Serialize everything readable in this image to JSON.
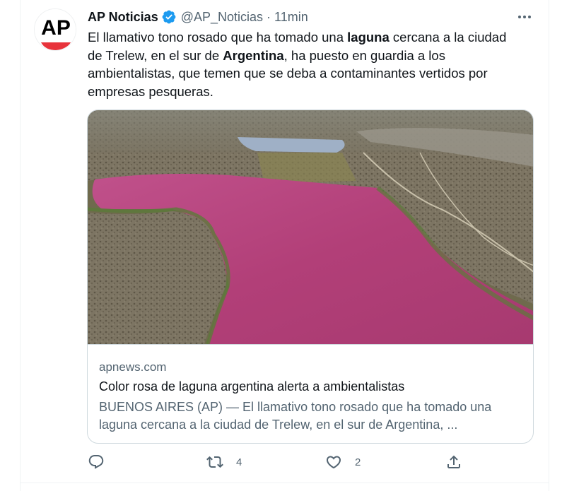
{
  "tweet": {
    "author": {
      "display_name": "AP Noticias",
      "handle": "@AP_Noticias",
      "logo_text": "AP",
      "verified": true
    },
    "separator": "·",
    "time": "11min",
    "text_parts": [
      {
        "t": "El llamativo tono rosado que ha tomado una ",
        "b": false
      },
      {
        "t": "laguna",
        "b": true
      },
      {
        "t": " cercana a la ciudad de Trelew, en el sur de ",
        "b": false
      },
      {
        "t": "Argentina",
        "b": true
      },
      {
        "t": ", ha puesto en guardia a los ambientalistas, que temen que se deba a contaminantes vertidos por empresas pesqueras.",
        "b": false
      }
    ],
    "card": {
      "domain": "apnews.com",
      "title": "Color rosa de laguna argentina alerta a ambientalistas",
      "description": "BUENOS AIRES (AP) — El llamativo tono rosado que ha tomado una laguna cercana a la ciudad de Trelew, en el sur de Argentina, ..."
    },
    "actions": {
      "reply_count": "",
      "retweet_count": "4",
      "like_count": "2"
    }
  },
  "colors": {
    "verified_blue": "#1d9bf0",
    "text_primary": "#0f1419",
    "text_secondary": "#536471",
    "border": "#cfd9de",
    "logo_red": "#e8333b",
    "lagoon_pink": "#b4407a"
  },
  "icons": [
    "verified-badge-icon",
    "more-icon",
    "reply-icon",
    "retweet-icon",
    "like-icon",
    "share-icon"
  ]
}
